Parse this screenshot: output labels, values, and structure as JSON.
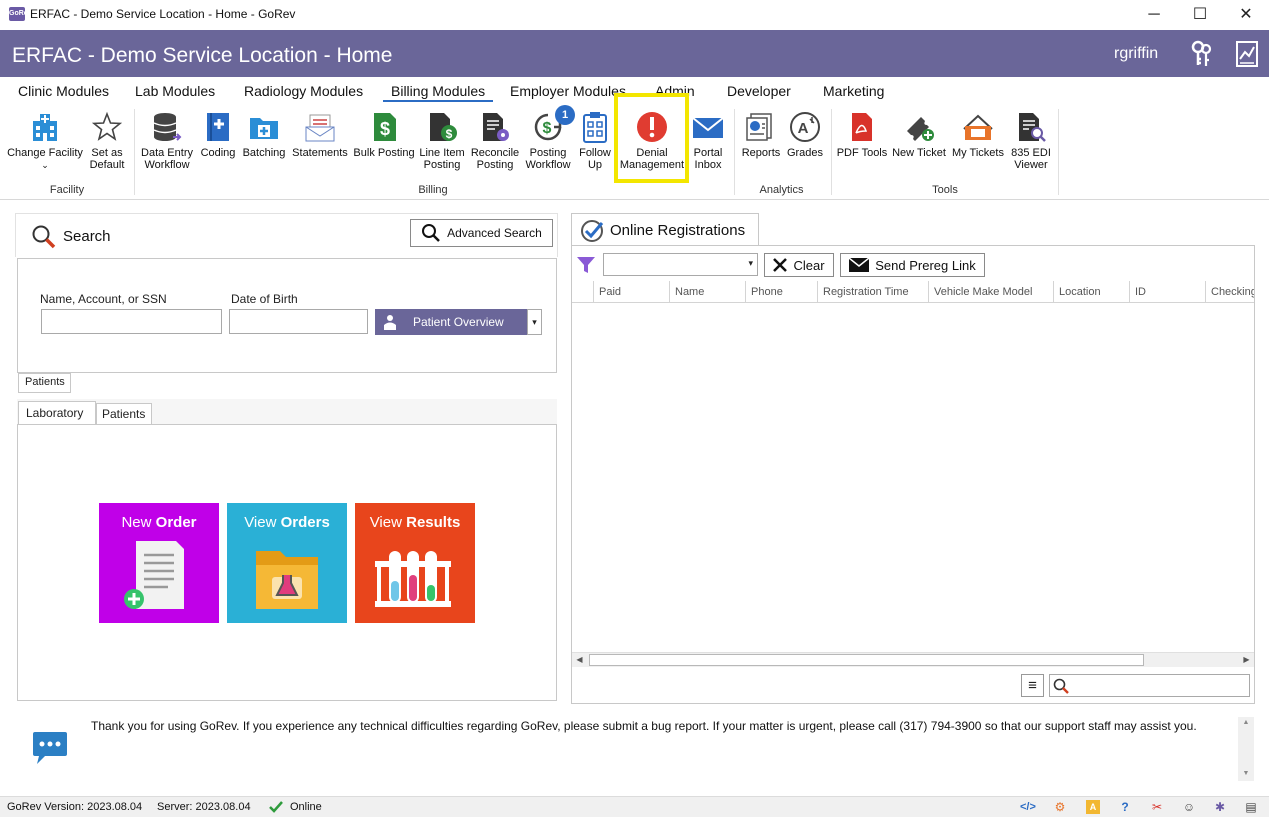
{
  "window": {
    "title": "ERFAC - Demo Service Location - Home - GoRev",
    "icon_text": "GoRev",
    "controls": [
      "─",
      "☐",
      "✕"
    ]
  },
  "header": {
    "title": "ERFAC - Demo Service Location - Home",
    "username": "rgriffin"
  },
  "menu_tabs": [
    "Clinic Modules",
    "Lab Modules",
    "Radiology Modules",
    "Billing Modules",
    "Employer Modules",
    "Admin",
    "Developer",
    "Marketing"
  ],
  "active_tab": "Billing Modules",
  "ribbon": {
    "facility": {
      "group": "Facility",
      "change_facility": "Change Facility",
      "set_default_1": "Set as",
      "set_default_2": "Default"
    },
    "billing": {
      "group": "Billing",
      "data_entry_1": "Data Entry",
      "data_entry_2": "Workflow",
      "coding": "Coding",
      "batching": "Batching",
      "statements": "Statements",
      "bulk_posting": "Bulk Posting",
      "line_item_1": "Line Item",
      "line_item_2": "Posting",
      "reconcile_1": "Reconcile",
      "reconcile_2": "Posting",
      "posting_wf_1": "Posting",
      "posting_wf_2": "Workflow",
      "posting_wf_badge": "1",
      "follow_up_1": "Follow",
      "follow_up_2": "Up",
      "denial_1": "Denial",
      "denial_2": "Management",
      "portal_1": "Portal",
      "portal_2": "Inbox"
    },
    "analytics": {
      "group": "Analytics",
      "reports": "Reports",
      "grades": "Grades"
    },
    "tools": {
      "group": "Tools",
      "pdf_tools": "PDF Tools",
      "new_ticket": "New Ticket",
      "my_tickets": "My Tickets",
      "edi_1": "835 EDI",
      "edi_2": "Viewer"
    }
  },
  "search": {
    "title": "Search",
    "advanced_search": "Advanced Search",
    "name_label": "Name, Account, or SSN",
    "name_value": "",
    "dob_label": "Date of Birth",
    "dob_value": "",
    "patient_overview": "Patient Overview",
    "bottom_tab": "Patients"
  },
  "lab": {
    "tabs": [
      "Laboratory",
      "Patients"
    ],
    "tiles": [
      {
        "light": "New ",
        "bold": "Order",
        "color": "#c000e8"
      },
      {
        "light": "View ",
        "bold": "Orders",
        "color": "#2ab0d6"
      },
      {
        "light": "View ",
        "bold": "Results",
        "color": "#e8451c"
      }
    ]
  },
  "online_registrations": {
    "title": "Online Registrations",
    "filter_value": "",
    "clear_button": "Clear",
    "send_prereg": "Send Prereg Link",
    "columns": [
      "Paid",
      "Name",
      "Phone",
      "Registration Time",
      "Vehicle Make Model",
      "Location",
      "ID",
      "Checking"
    ],
    "rows": [],
    "search_value": ""
  },
  "message": {
    "text": "Thank you for using GoRev.  If you experience any technical difficulties regarding GoRev, please submit a bug report.  If your matter is urgent, please call (317) 794-3900 so that our support staff may assist you."
  },
  "status_bar": {
    "version": "GoRev Version: 2023.08.04",
    "server": "Server: 2023.08.04",
    "status": "Online"
  }
}
